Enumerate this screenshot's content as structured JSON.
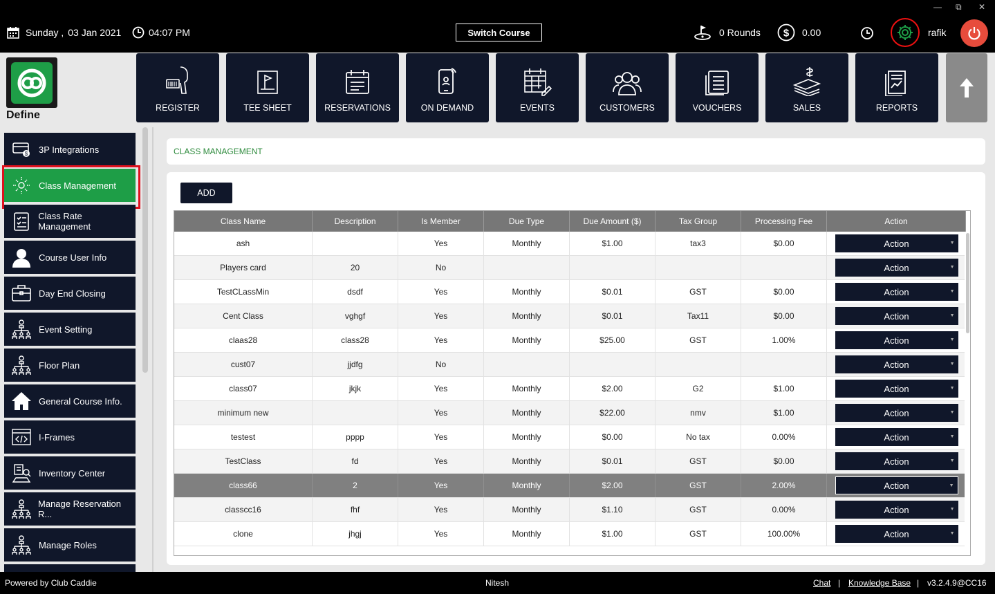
{
  "topbar": {
    "day": "Sunday ,",
    "date": "03 Jan 2021",
    "time": "04:07 PM",
    "switch_course": "Switch Course",
    "rounds": "0 Rounds",
    "balance": "0.00",
    "user": "rafik",
    "window_minimize": "—",
    "window_restore": "⧉",
    "window_close": "✕"
  },
  "logo": {
    "label": "Define"
  },
  "nav": [
    {
      "label": "REGISTER",
      "icon": "barcode-scanner-icon"
    },
    {
      "label": "TEE SHEET",
      "icon": "flag-icon"
    },
    {
      "label": "RESERVATIONS",
      "icon": "calendar-list-icon"
    },
    {
      "label": "ON DEMAND",
      "icon": "mobile-icon"
    },
    {
      "label": "EVENTS",
      "icon": "calendar-edit-icon"
    },
    {
      "label": "CUSTOMERS",
      "icon": "users-icon"
    },
    {
      "label": "VOUCHERS",
      "icon": "voucher-icon"
    },
    {
      "label": "SALES",
      "icon": "money-icon"
    },
    {
      "label": "REPORTS",
      "icon": "report-icon"
    }
  ],
  "sidebar": {
    "items": [
      {
        "label": "3P Integrations",
        "icon": "card-icon"
      },
      {
        "label": "Class Management",
        "icon": "class-icon",
        "active": true
      },
      {
        "label": "Class Rate Management",
        "icon": "checklist-icon"
      },
      {
        "label": "Course User Info",
        "icon": "user-icon"
      },
      {
        "label": "Day End Closing",
        "icon": "briefcase-icon"
      },
      {
        "label": "Event Setting",
        "icon": "hierarchy-icon"
      },
      {
        "label": "Floor Plan",
        "icon": "hierarchy-icon"
      },
      {
        "label": "General Course Info.",
        "icon": "home-icon"
      },
      {
        "label": "I-Frames",
        "icon": "code-icon"
      },
      {
        "label": "Inventory Center",
        "icon": "inventory-icon"
      },
      {
        "label": "Manage Reservation R...",
        "icon": "hierarchy-icon"
      },
      {
        "label": "Manage Roles",
        "icon": "hierarchy-icon"
      }
    ]
  },
  "page": {
    "title": "CLASS MANAGEMENT",
    "add_label": "ADD"
  },
  "table": {
    "columns": [
      "Class Name",
      "Description",
      "Is Member",
      "Due Type",
      "Due Amount ($)",
      "Tax Group",
      "Processing Fee",
      "Action"
    ],
    "action_label": "Action",
    "rows": [
      [
        "ash",
        "",
        "Yes",
        "Monthly",
        "$1.00",
        "tax3",
        "$0.00"
      ],
      [
        "Players card",
        "20",
        "No",
        "",
        "",
        "",
        ""
      ],
      [
        "TestCLassMin",
        "dsdf",
        "Yes",
        "Monthly",
        "$0.01",
        "GST",
        "$0.00"
      ],
      [
        "Cent Class",
        "vghgf",
        "Yes",
        "Monthly",
        "$0.01",
        "Tax11",
        "$0.00"
      ],
      [
        "claas28",
        "class28",
        "Yes",
        "Monthly",
        "$25.00",
        "GST",
        "1.00%"
      ],
      [
        "cust07",
        "jjdfg",
        "No",
        "",
        "",
        "",
        ""
      ],
      [
        "class07",
        "jkjk",
        "Yes",
        "Monthly",
        "$2.00",
        "G2",
        "$1.00"
      ],
      [
        "minimum new",
        "",
        "Yes",
        "Monthly",
        "$22.00",
        "nmv",
        "$1.00"
      ],
      [
        "testest",
        "pppp",
        "Yes",
        "Monthly",
        "$0.00",
        "No tax",
        "0.00%"
      ],
      [
        "TestClass",
        "fd",
        "Yes",
        "Monthly",
        "$0.01",
        "GST",
        "$0.00"
      ],
      [
        "class66",
        "2",
        "Yes",
        "Monthly",
        "$2.00",
        "GST",
        "2.00%"
      ],
      [
        "classcc16",
        "fhf",
        "Yes",
        "Monthly",
        "$1.10",
        "GST",
        "0.00%"
      ],
      [
        "clone",
        "jhgj",
        "Yes",
        "Monthly",
        "$1.00",
        "GST",
        "100.00%"
      ]
    ],
    "selected_row": 10
  },
  "footer": {
    "powered": "Powered by Club Caddie",
    "center": "Nitesh",
    "chat": "Chat",
    "sep": "|",
    "kb": "Knowledge Base",
    "version": "v3.2.4.9@CC16"
  },
  "colors": {
    "navy": "#10172a",
    "active_green": "#1e9e47",
    "title_green": "#2e8b3d",
    "highlight_red": "#e0101c"
  }
}
